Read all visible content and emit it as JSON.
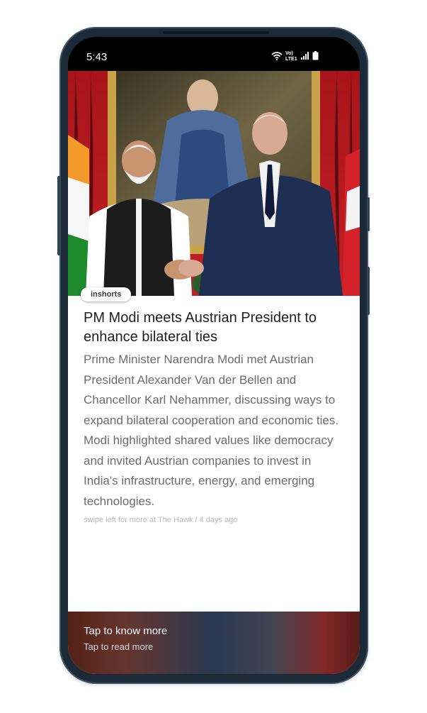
{
  "status_bar": {
    "time": "5:43",
    "network_label": "Vo) LTE1"
  },
  "article": {
    "source_tag": "inshorts",
    "headline": "PM Modi meets Austrian President to enhance bilateral ties",
    "body": "Prime Minister Narendra Modi met Austrian President Alexander Van der Bellen and Chancellor Karl Nehammer, discussing ways to expand bilateral cooperation and economic ties. Modi highlighted shared values like democracy and invited Austrian companies to invest in India's infrastructure, energy, and emerging technologies.",
    "meta": "swipe left for more at The Hawk / 4 days ago"
  },
  "footer": {
    "title": "Tap to know more",
    "subtitle": "Tap to read more"
  },
  "icons": [
    "wifi-icon",
    "signal-icon",
    "battery-icon"
  ],
  "colors": {
    "curtain_red": "#b3191c",
    "frame_gold": "#c9a24a",
    "suit_navy": "#1e2d52",
    "flag_saffron": "#ff9933",
    "flag_green": "#138808"
  }
}
